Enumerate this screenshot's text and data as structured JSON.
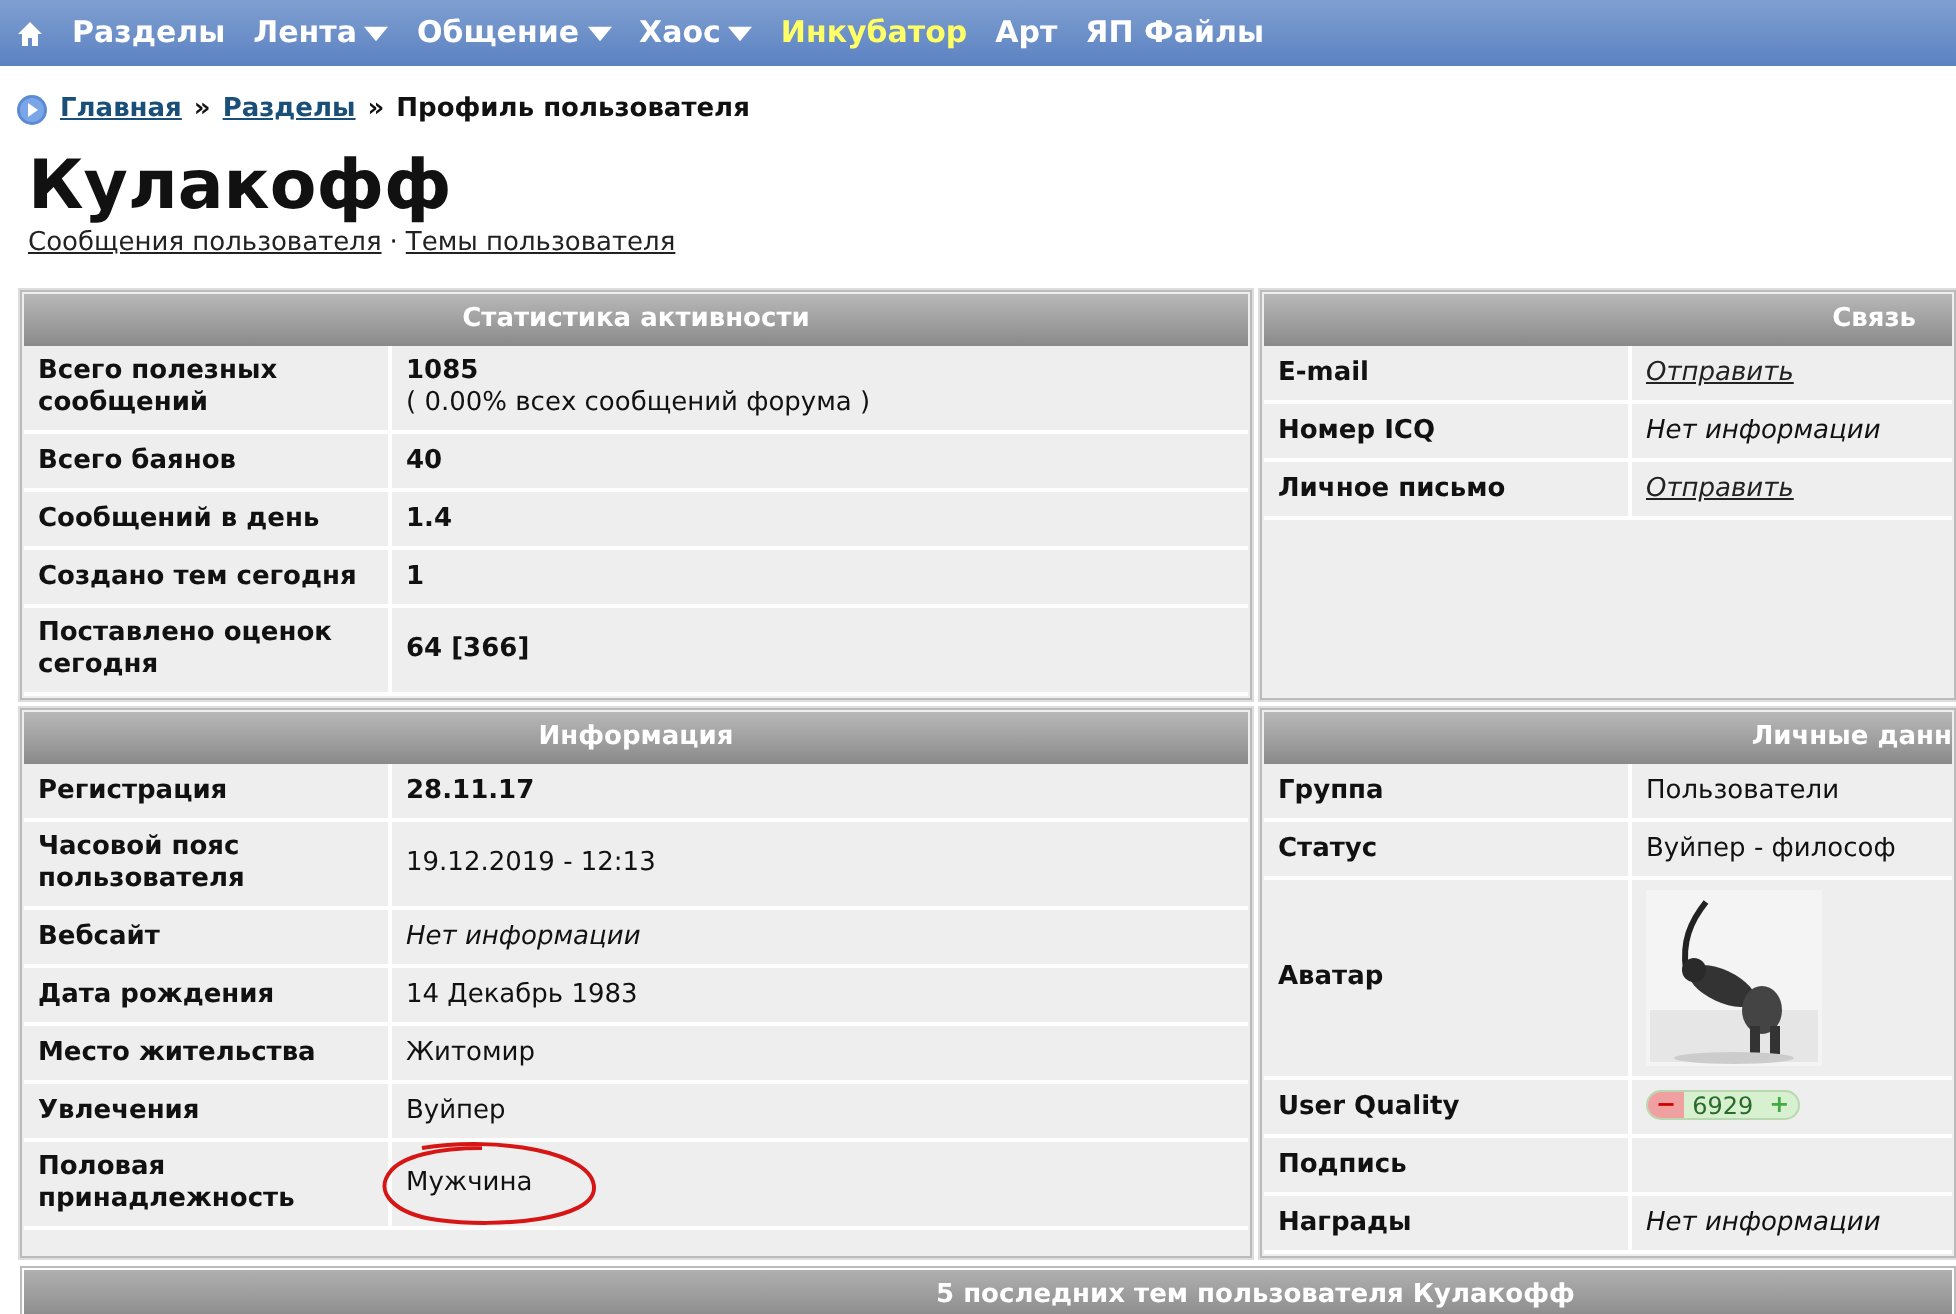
{
  "nav": {
    "items": [
      {
        "label": "Разделы",
        "dropdown": false,
        "highlighted": false
      },
      {
        "label": "Лента",
        "dropdown": true,
        "highlighted": false
      },
      {
        "label": "Общение",
        "dropdown": true,
        "highlighted": false
      },
      {
        "label": "Хаос",
        "dropdown": true,
        "highlighted": false
      },
      {
        "label": "Инкубатор",
        "dropdown": false,
        "highlighted": true
      },
      {
        "label": "Арт",
        "dropdown": false,
        "highlighted": false
      },
      {
        "label": "ЯП Файлы",
        "dropdown": false,
        "highlighted": false
      }
    ]
  },
  "breadcrumb": {
    "links": [
      "Главная",
      "Разделы"
    ],
    "separator": "»",
    "current": "Профиль пользователя"
  },
  "profile": {
    "name": "Кулакофф",
    "links": [
      "Сообщения пользователя",
      "Темы пользователя"
    ],
    "link_separator": "·"
  },
  "panels": [
    {
      "title": "Статистика активности",
      "rows": [
        {
          "label": "Всего полезных сообщений",
          "kind": "bold",
          "value": "1085",
          "note": "( 0.00% всех сообщений форума )"
        },
        {
          "label": "Всего баянов",
          "kind": "bold",
          "value": "40"
        },
        {
          "label": "Сообщений в день",
          "kind": "bold",
          "value": "1.4"
        },
        {
          "label": "Создано тем сегодня",
          "kind": "bold",
          "value": "1"
        },
        {
          "label": "Поставлено оценок сегодня",
          "kind": "bold",
          "value": "64 [366]"
        }
      ]
    },
    {
      "title": "Связь",
      "rows": [
        {
          "label": "E-mail",
          "kind": "link",
          "value": "Отправить"
        },
        {
          "label": "Номер ICQ",
          "kind": "italic",
          "value": "Нет информации"
        },
        {
          "label": "Личное письмо",
          "kind": "link",
          "value": "Отправить"
        }
      ]
    },
    {
      "title": "Информация",
      "rows": [
        {
          "label": "Регистрация",
          "kind": "bold",
          "value": "28.11.17"
        },
        {
          "label": "Часовой пояс пользователя",
          "kind": "plain",
          "value": "19.12.2019 - 12:13"
        },
        {
          "label": "Вебсайт",
          "kind": "italic",
          "value": "Нет информации"
        },
        {
          "label": "Дата рождения",
          "kind": "plain",
          "value": "14 Декабрь 1983"
        },
        {
          "label": "Место жительства",
          "kind": "plain",
          "value": "Житомир"
        },
        {
          "label": "Увлечения",
          "kind": "plain",
          "value": "Вуйпер"
        },
        {
          "label": "Половая принадлежность",
          "kind": "plain",
          "value": "Мужчина",
          "circled": true
        }
      ]
    },
    {
      "title": "Личные данн",
      "rows": [
        {
          "label": "Группа",
          "kind": "plain",
          "value": "Пользователи"
        },
        {
          "label": "Статус",
          "kind": "plain",
          "value": "Вуйпер - философ"
        },
        {
          "label": "Аватар",
          "kind": "avatar"
        },
        {
          "label": "User Quality",
          "kind": "rating",
          "value": "6929",
          "minus": "−",
          "plus": "+"
        },
        {
          "label": "Подпись",
          "kind": "empty"
        },
        {
          "label": "Награды",
          "kind": "italic",
          "value": "Нет информации"
        }
      ]
    }
  ],
  "bottom_bar": {
    "title": "5 последних тем пользователя Кулакофф"
  }
}
